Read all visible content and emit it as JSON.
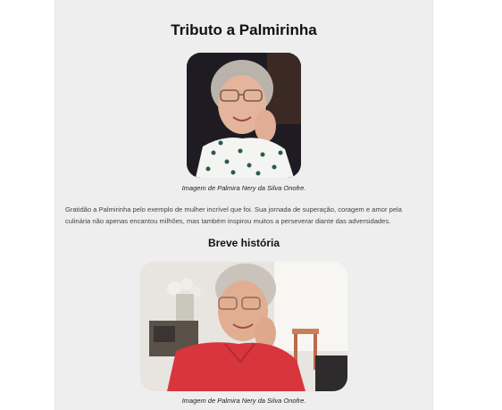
{
  "tribute": {
    "title": "Tributo a Palmirinha",
    "photo1_caption": "Imagem de Palmira Nery da Silva Onofre.",
    "paragraph": "Gratidão a Palmirinha pelo exemplo de mulher incrível que foi. Sua jornada de superação, coragem e amor pela culinária não apenas encantou milhões, mas também inspirou muitos a perseverar diante das adversidades.",
    "history_heading": "Breve história",
    "photo2_caption": "Imagem de Palmira Nery da Silva Onofre."
  }
}
